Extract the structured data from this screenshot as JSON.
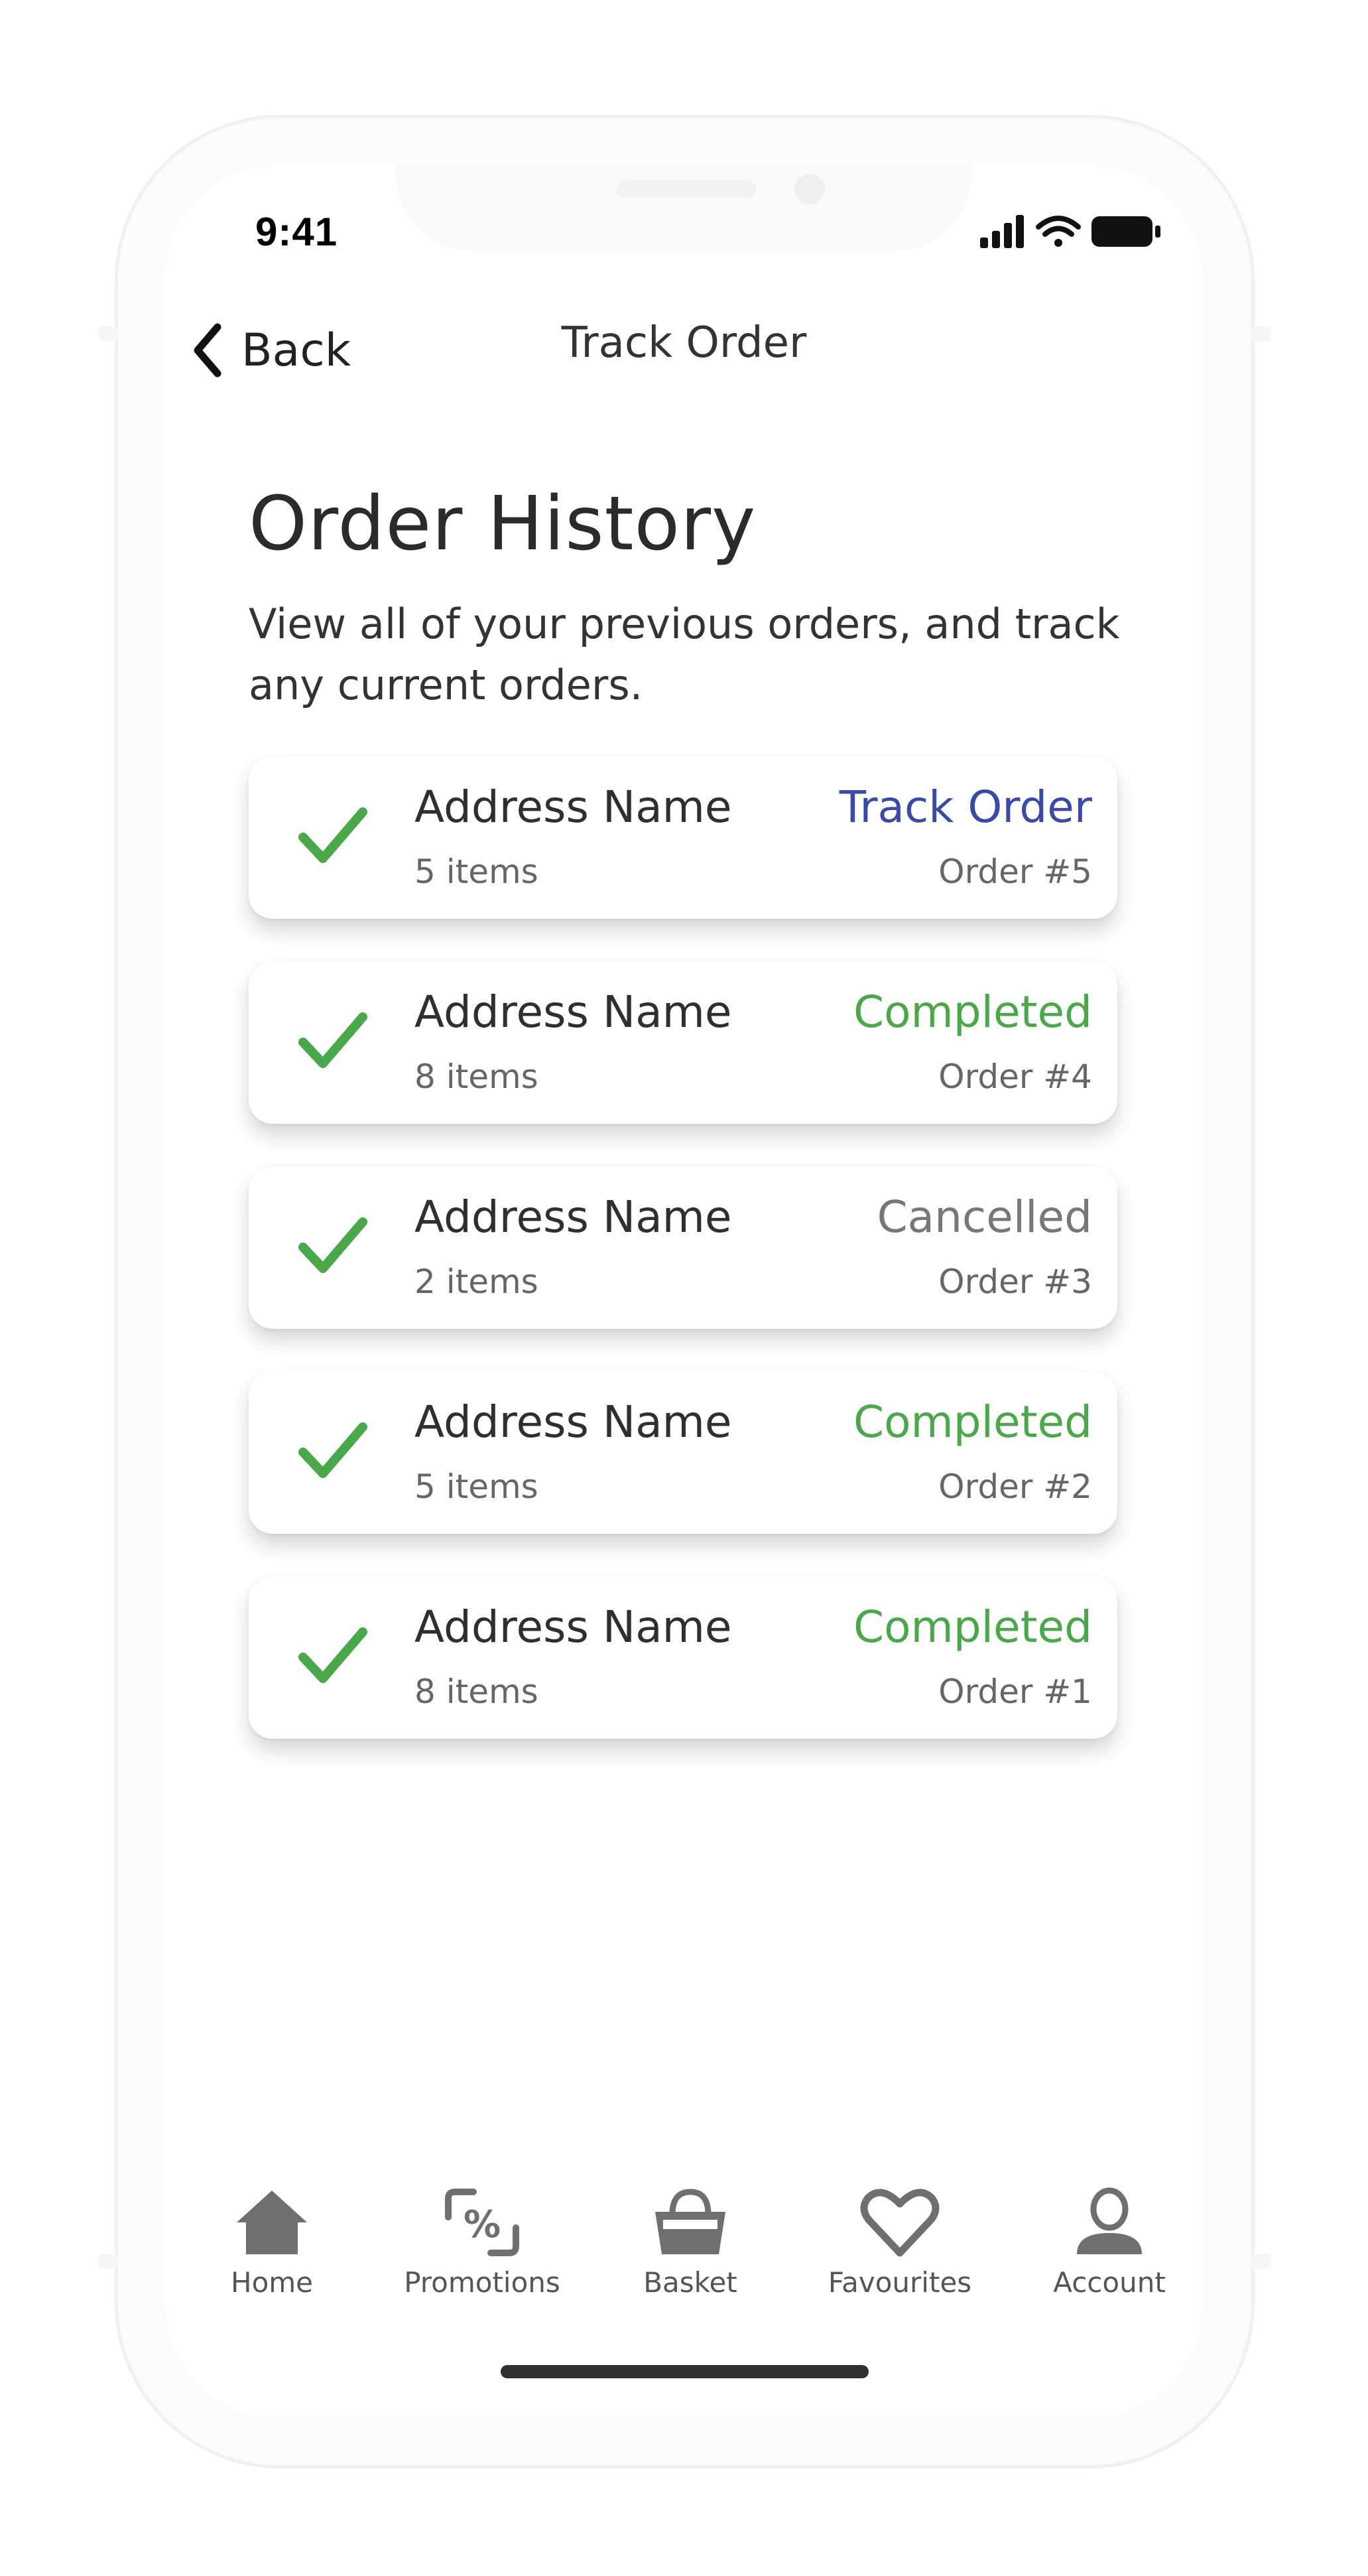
{
  "status_bar": {
    "time": "9:41",
    "signal_icon": "cellular-signal-icon",
    "wifi_icon": "wifi-icon",
    "battery_icon": "battery-icon"
  },
  "nav": {
    "back_label": "Back",
    "back_icon": "chevron-left-icon",
    "title": "Track Order"
  },
  "page": {
    "title": "Order History",
    "description": "View all of your previous orders, and track any current orders."
  },
  "colors": {
    "check_green": "#4aa84a",
    "completed_green": "#4aa84a",
    "track_blue": "#3b4aa6",
    "cancelled_gray": "#777777",
    "tab_icon_gray": "#6f6f6f"
  },
  "orders": [
    {
      "address": "Address Name",
      "items": "5 items",
      "status": "Track Order",
      "status_type": "track",
      "order_no": "Order #5"
    },
    {
      "address": "Address Name",
      "items": "8 items",
      "status": "Completed",
      "status_type": "completed",
      "order_no": "Order #4"
    },
    {
      "address": "Address Name",
      "items": "2 items",
      "status": "Cancelled",
      "status_type": "cancelled",
      "order_no": "Order #3"
    },
    {
      "address": "Address Name",
      "items": "5 items",
      "status": "Completed",
      "status_type": "completed",
      "order_no": "Order #2"
    },
    {
      "address": "Address Name",
      "items": "8 items",
      "status": "Completed",
      "status_type": "completed",
      "order_no": "Order #1"
    }
  ],
  "tabbar": {
    "items": [
      {
        "label": "Home",
        "icon": "home-icon"
      },
      {
        "label": "Promotions",
        "icon": "promotions-icon"
      },
      {
        "label": "Basket",
        "icon": "basket-icon"
      },
      {
        "label": "Favourites",
        "icon": "heart-icon"
      },
      {
        "label": "Account",
        "icon": "account-icon"
      }
    ]
  }
}
